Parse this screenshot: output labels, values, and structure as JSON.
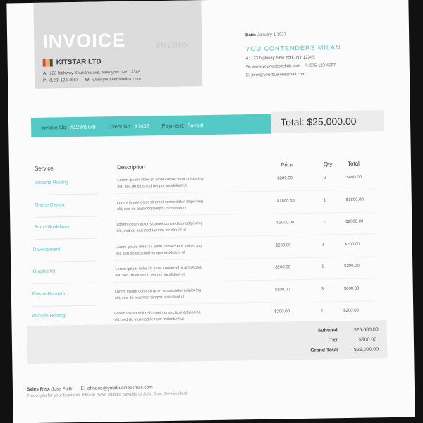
{
  "header": {
    "title": "INVOICE",
    "company_name": "KITSTAR LTD",
    "company_colors": [
      "#e0443a",
      "#f3b13a",
      "#4a4a4a"
    ],
    "address_label": "A:",
    "address": "123 highway Souriana ave, New york, NY 12345",
    "phone_label": "P:",
    "phone": "(123) 123-4567",
    "web_label": "W:",
    "web": "www.yourwebsitelink.com",
    "watermark": "envato"
  },
  "client": {
    "date_label": "Date:",
    "date": "January 1 2017",
    "name": "YOU CONTENDERS MILAN",
    "address": "A: 123 highway New York, NY 12345",
    "website": "W: www.yourwebsitelink.com",
    "phone": "P: 075 123 4567",
    "email": "E: john@yourbusinessmail.com"
  },
  "bar": {
    "invoice_no_label": "Invoice No:",
    "invoice_no": "#123456/B",
    "client_no_label": "Client No:",
    "client_no": "#1432",
    "payment_label": "Payment:",
    "payment": "Paypal",
    "total": "Total: $25,000.00"
  },
  "table": {
    "headers": {
      "service": "Service",
      "description": "Description",
      "price": "Price",
      "qty": "Qty",
      "total": "Total"
    },
    "rows": [
      {
        "service": "Website Hosting",
        "desc1": "Lorem ipsum dolor sit amet consectetur adipiscing",
        "desc2": "elit, sed do eiusmod tempor incididunt ut",
        "price": "$200.00",
        "qty": "2",
        "total": "$400.00"
      },
      {
        "service": "Theme Design",
        "desc1": "Lorem ipsum dolor sit amet consectetur adipiscing",
        "desc2": "elit, sed do eiusmod tempor incididunt ut",
        "price": "$1800.00",
        "qty": "1",
        "total": "$1800.00"
      },
      {
        "service": "Brand Guidelines",
        "desc1": "Lorem ipsum dolor sit amet consectetur adipiscing",
        "desc2": "elit, sed do eiusmod tempor incididunt ut",
        "price": "$2000.00",
        "qty": "1",
        "total": "$2000.00"
      },
      {
        "service": "Development",
        "desc1": "Lorem ipsum dolor sit amet consectetur adipiscing",
        "desc2": "elit, sed do eiusmod tempor incididunt ut",
        "price": "$200.00",
        "qty": "1",
        "total": "$200.00"
      },
      {
        "service": "Graphic Kit",
        "desc1": "Lorem ipsum dolor sit amet consectetur adipiscing",
        "desc2": "elit, sed do eiusmod tempor incididunt ut",
        "price": "$200.00",
        "qty": "1",
        "total": "$200.00"
      },
      {
        "service": "Private Banners",
        "desc1": "Lorem ipsum dolor sit amet consectetur adipiscing",
        "desc2": "elit, sed do eiusmod tempor incididunt ut",
        "price": "$200.00",
        "qty": "3",
        "total": "$600.00"
      },
      {
        "service": "Website Hosting",
        "desc1": "Lorem ipsum dolor sit amet consectetur adipiscing",
        "desc2": "elit, sed do eiusmod tempor incididunt ut",
        "price": "$200.00",
        "qty": "1",
        "total": "$200.00"
      }
    ]
  },
  "summary": {
    "subtotal_label": "Subtotal",
    "subtotal": "$25,000.00",
    "tax_label": "Tax",
    "tax": "$500.00",
    "grand_total_label": "Grand Total",
    "grand_total": "$25,000.00"
  },
  "footer": {
    "sales_rep_label": "Sales Rep:",
    "sales_rep": "Jose Fuller",
    "email": "E: johndoe@yourbusinessmail.com",
    "note": "Thank you for your business. Please make checks payable to John Doe. Go-excellent"
  },
  "colors": {
    "accent": "#55c9c5",
    "panel": "#ececec"
  }
}
